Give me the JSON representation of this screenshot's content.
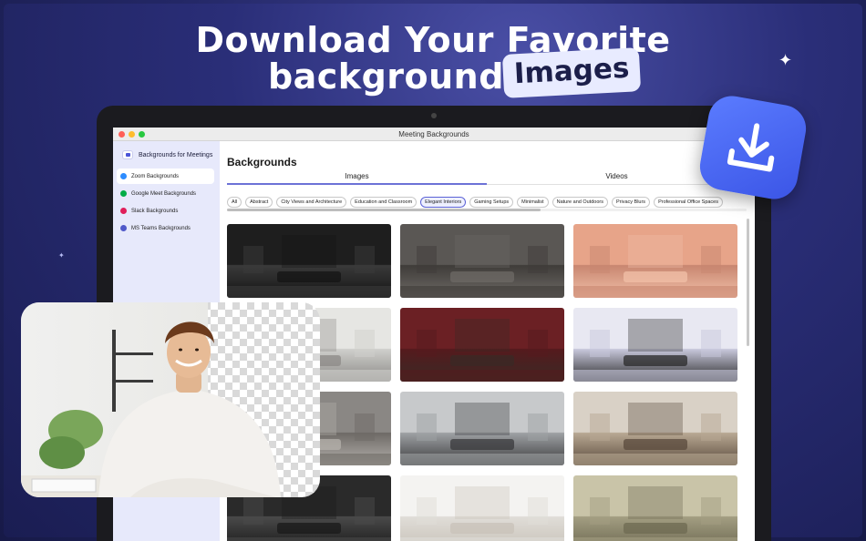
{
  "headline": {
    "line1": "Download Your Favorite",
    "line2": "backgrounds",
    "pill": "Images"
  },
  "window": {
    "title": "Meeting Backgrounds",
    "traffic_lights": [
      "#ff5f57",
      "#febc2e",
      "#28c840"
    ]
  },
  "sidebar": {
    "app_name": "Backgrounds for Meetings",
    "items": [
      {
        "label": "Zoom Backgrounds",
        "icon": "zoom-icon",
        "color": "#2d8cff",
        "active": true
      },
      {
        "label": "Google Meet Backgrounds",
        "icon": "google-meet-icon",
        "color": "#00ac47",
        "active": false
      },
      {
        "label": "Slack Backgrounds",
        "icon": "slack-icon",
        "color": "#e01e5a",
        "active": false
      },
      {
        "label": "MS Teams Backgrounds",
        "icon": "teams-icon",
        "color": "#5059c9",
        "active": false
      }
    ]
  },
  "main": {
    "title": "Backgrounds",
    "tabs": [
      "Images",
      "Videos"
    ],
    "active_tab": "Images",
    "filters": [
      "All",
      "Abstract",
      "City Views and Architecture",
      "Education and Classroom",
      "Elegant Interiors",
      "Gaming Setups",
      "Minimalist",
      "Nature and Outdoors",
      "Privacy Blurs",
      "Professional Office Spaces"
    ],
    "selected_filter": "Elegant Interiors",
    "thumbnails": [
      {
        "name": "dark-panel-room",
        "colors": [
          "#1e1e1e",
          "#3a3a3a",
          "#141414"
        ]
      },
      {
        "name": "grey-lounge-wall-lights",
        "colors": [
          "#5a5754",
          "#3f3c39",
          "#6e6a66"
        ]
      },
      {
        "name": "peach-living-room",
        "colors": [
          "#e7a489",
          "#c88670",
          "#f1c0a8"
        ]
      },
      {
        "name": "white-paneled-room",
        "colors": [
          "#e6e6e3",
          "#cfcfcc",
          "#8c8a87"
        ]
      },
      {
        "name": "maroon-room-window",
        "colors": [
          "#6b2024",
          "#551a1d",
          "#3a2a26"
        ]
      },
      {
        "name": "lavender-console-table",
        "colors": [
          "#e8e8f2",
          "#c8c8dc",
          "#2a2a2a"
        ]
      },
      {
        "name": "geometric-wall-lounge",
        "colors": [
          "#8a8784",
          "#6e6a66",
          "#b5b1ac"
        ]
      },
      {
        "name": "grey-modern-lounge",
        "colors": [
          "#c7c9cb",
          "#9ea1a4",
          "#3a3a3c"
        ]
      },
      {
        "name": "chandelier-hall",
        "colors": [
          "#d9d1c6",
          "#b8a893",
          "#5a4a3c"
        ]
      },
      {
        "name": "dark-pattern-wall",
        "colors": [
          "#2a2a2a",
          "#4a4a4a",
          "#1a1a1a"
        ]
      },
      {
        "name": "white-arch-lounge",
        "colors": [
          "#f4f3f1",
          "#e0ddd8",
          "#c8c2b8"
        ]
      },
      {
        "name": "olive-grand-hall",
        "colors": [
          "#c9c4a8",
          "#a39e82",
          "#6e6a52"
        ]
      }
    ]
  },
  "download_badge": {
    "icon": "download-icon"
  }
}
